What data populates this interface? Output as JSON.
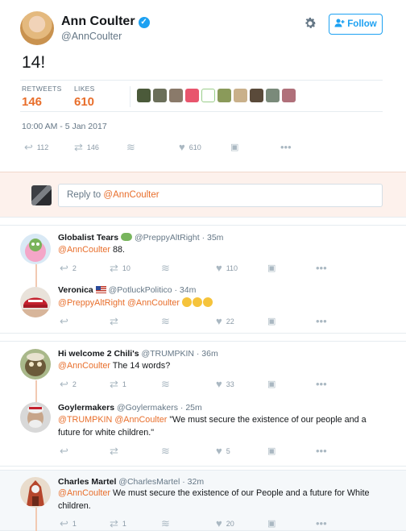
{
  "main_tweet": {
    "author_name": "Ann Coulter",
    "author_handle": "@AnnCoulter",
    "follow_label": "Follow",
    "text": "14!",
    "retweets_label": "RETWEETS",
    "retweets_count": "146",
    "likes_label": "LIKES",
    "likes_count": "610",
    "timestamp": "10:00 AM - 5 Jan 2017",
    "actions": {
      "reply": "112",
      "retweet": "146",
      "like": "610"
    },
    "liker_avatar_colors": [
      "#4b5a3a",
      "#6b6f5a",
      "#8a7a6a",
      "#e8556d",
      "#ffffff",
      "#8a9a5a",
      "#c9b08a",
      "#5a4a3a",
      "#7a8a7a",
      "#b0707a"
    ]
  },
  "reply_box": {
    "prompt": "Reply to ",
    "mention": "@AnnCoulter"
  },
  "replies": [
    {
      "name": "Globalist Tears",
      "handle": "@PreppyAltRight",
      "time": "35m",
      "mention": "@AnnCoulter",
      "text": " 88.",
      "reply_count": "2",
      "retweet_count": "10",
      "like_count": "110",
      "avatar_color": "#f4a6c8"
    },
    {
      "name": "Veronica",
      "handle": "@PotluckPolitico",
      "time": "34m",
      "mention": "@PreppyAltRight @AnnCoulter",
      "text": "",
      "reply_count": "",
      "retweet_count": "",
      "like_count": "22",
      "avatar_color": "#c4212e"
    },
    {
      "name": "Hi welcome 2 Chili's",
      "handle": "@TRUMPKIN",
      "time": "36m",
      "mention": "@AnnCoulter",
      "text": " The 14 words?",
      "reply_count": "2",
      "retweet_count": "1",
      "like_count": "33",
      "avatar_color": "#6b7a4a"
    },
    {
      "name": "Goylermakers",
      "handle": "@Goylermakers",
      "time": "25m",
      "mention": "@TRUMPKIN @AnnCoulter",
      "text": " \"We must secure the existence of our people and a",
      "text2": "future for white children.\"",
      "reply_count": "",
      "retweet_count": "",
      "like_count": "5",
      "avatar_color": "#8a8a8a"
    },
    {
      "name": "Charles Martel",
      "handle": "@CharlesMartel",
      "time": "32m",
      "mention": "@AnnCoulter",
      "text": " We must secure the existence of our People and a future for White",
      "text2": "children.",
      "reply_count": "1",
      "retweet_count": "1",
      "like_count": "20",
      "avatar_color": "#b5462c"
    }
  ],
  "separator": "·",
  "accent_color": "#e86e2b",
  "link_color": "#1da1f2"
}
